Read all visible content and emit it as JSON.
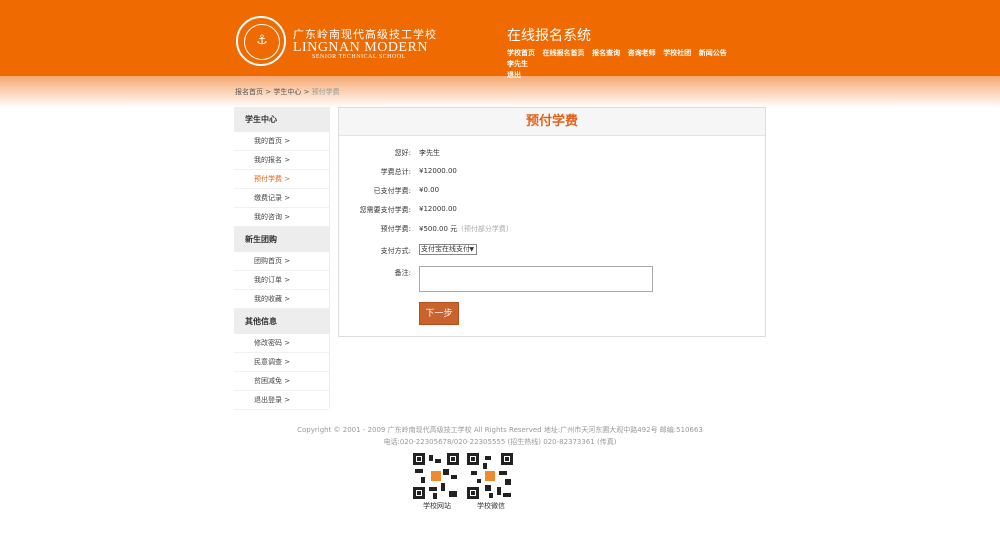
{
  "header": {
    "school_cn": "广东岭南现代高级技工学校",
    "school_en": "LINGNAN MODERN",
    "school_sub": "SENIOR TECHNICAL SCHOOL",
    "system_title": "在线报名系统",
    "nav": [
      "学校首页",
      "在线报名首页",
      "报名查询",
      "咨询老师",
      "学校社团",
      "新闻公告",
      "李先生",
      "退出"
    ]
  },
  "breadcrumb": {
    "items": [
      "报名首页",
      "学生中心",
      "预付学费"
    ],
    "separator": ">"
  },
  "sidebar": {
    "groups": [
      {
        "title": "学生中心",
        "items": [
          "我的首页 >",
          "我的报名 >",
          "预付学费 >",
          "缴费记录 >",
          "我的咨询 >"
        ]
      },
      {
        "title": "新生团购",
        "items": [
          "团购首页 >",
          "我的订单 >",
          "我的收藏 >"
        ]
      },
      {
        "title": "其他信息",
        "items": [
          "修改密码 >",
          "民意调查 >",
          "贫困减免 >",
          "退出登录 >"
        ]
      }
    ],
    "active": "预付学费 >"
  },
  "form": {
    "title": "预付学费",
    "greeting_label": "您好:",
    "greeting_value": "李先生",
    "total_label": "学费总计:",
    "total_value": "¥12000.00",
    "paid_label": "已支付学费:",
    "paid_value": "¥0.00",
    "need_label": "您需要支付学费:",
    "need_value": "¥12000.00",
    "prepay_label": "预付学费:",
    "prepay_value": "¥500.00 元",
    "prepay_hint": "(预付部分学费)",
    "method_label": "支付方式:",
    "method_value": "支付宝在线支付",
    "note_label": "备注:",
    "next_button": "下一步"
  },
  "footer": {
    "line1": "Copyright © 2001 - 2009 广东岭南现代高级技工学校 All Rights Reserved 地址:广州市天河东圃大观中路492号 邮编:510663",
    "line2": "电话:020-22305678/020-22305555 (招生热线)   020-82373361 (传真)",
    "qr_labels": [
      "学校网站",
      "学校微信"
    ]
  },
  "colors": {
    "brand": "#ef6a00",
    "accent": "#e0621a",
    "button": "#c9622d"
  }
}
